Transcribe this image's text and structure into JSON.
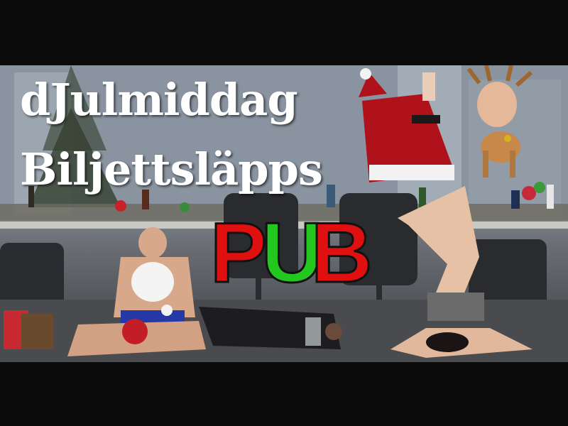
{
  "title_line_1": "dJulmiddag",
  "title_line_2": "Biljettsläpps",
  "pub": {
    "letters": [
      "P",
      "U",
      "B"
    ],
    "colors": [
      "#e01010",
      "#22c81e",
      "#e01010"
    ]
  },
  "colors": {
    "title": "#ffffff",
    "letterbox": "#0b0b0b"
  }
}
